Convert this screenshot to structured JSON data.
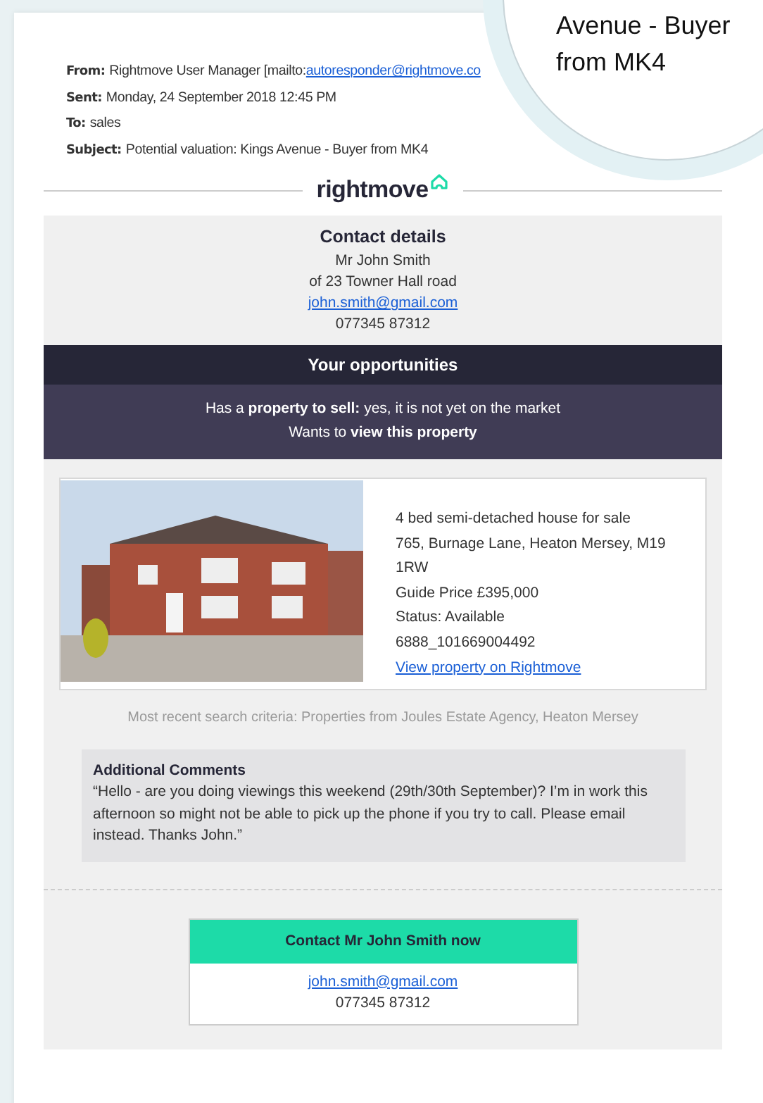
{
  "header_fields": [
    {
      "label": "From:",
      "value": "Rightmove User Manager [mailto:",
      "link": "autoresponder@rightmove.co"
    },
    {
      "label": "Sent:",
      "value": "Monday, 24 September 2018 12:45 PM"
    },
    {
      "label": "To:",
      "value": "sales"
    },
    {
      "label": "Subject:",
      "value": "Potential valuation: Kings Avenue - Buyer from MK4"
    }
  ],
  "logo": {
    "text": "rightmove"
  },
  "contact_details": {
    "title": "Contact details",
    "name": "Mr John Smith",
    "address": "of  23 Towner Hall road",
    "email": "john.smith@gmail.com",
    "phone": "077345 87312"
  },
  "opportunities": {
    "title": "Your opportunities",
    "lines": [
      "Has a **property to sell:** yes, it is not yet on the market",
      "Wants to **view this property**"
    ]
  },
  "property": {
    "lines": [
      "4 bed semi-detached house for sale",
      "765, Burnage Lane, Heaton Mersey, M19 1RW",
      "Guide Price £395,000",
      "Status: Available",
      "6888_101669004492"
    ],
    "link": "View property on Rightmove"
  },
  "search_criteria": "Most recent search criteria: Properties from Joules Estate Agency, Heaton Mersey",
  "comments": {
    "title": "Additional Comments",
    "text": "“Hello - are you doing viewings this weekend (29th/30th September)? I’m in work this afternoon so might not be able to pick up the phone if you try to call. Please email instead. Thanks John.”"
  },
  "contact_box": {
    "title": "Contact Mr John Smith now",
    "email": "john.smith@gmail.com",
    "phone": "077345 87312"
  },
  "magnifier": {
    "lines": [
      "Avenue - Buyer",
      "from MK4"
    ]
  }
}
